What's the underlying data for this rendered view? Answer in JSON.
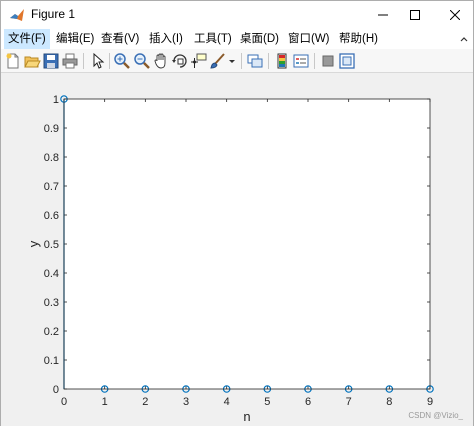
{
  "window": {
    "title": "Figure 1"
  },
  "menu": {
    "items": [
      {
        "label": "文件(F)"
      },
      {
        "label": "编辑(E)"
      },
      {
        "label": "查看(V)"
      },
      {
        "label": "插入(I)"
      },
      {
        "label": "工具(T)"
      },
      {
        "label": "桌面(D)"
      },
      {
        "label": "窗口(W)"
      },
      {
        "label": "帮助(H)"
      }
    ]
  },
  "toolbar": {
    "icons": [
      "new-figure-icon",
      "open-file-icon",
      "save-icon",
      "print-icon",
      "pointer-icon",
      "zoom-in-icon",
      "zoom-out-icon",
      "pan-icon",
      "rotate-3d-icon",
      "data-cursor-icon",
      "brush-icon",
      "link-plot-icon",
      "colorbar-icon",
      "legend-icon",
      "hide-plot-tools-icon",
      "show-plot-tools-icon"
    ]
  },
  "colors": {
    "series": "#0072bd",
    "axes": "#262626",
    "plot_bg": "#ffffff",
    "figure_bg": "#f0f0f0"
  },
  "chart_data": {
    "type": "stem",
    "title": "",
    "xlabel": "n",
    "ylabel": "y",
    "x": [
      0,
      1,
      2,
      3,
      4,
      5,
      6,
      7,
      8,
      9
    ],
    "y": [
      1,
      0,
      0,
      0,
      0,
      0,
      0,
      0,
      0,
      0
    ],
    "xlim": [
      0,
      9
    ],
    "ylim": [
      0,
      1
    ],
    "xticks": [
      "0",
      "1",
      "2",
      "3",
      "4",
      "5",
      "6",
      "7",
      "8",
      "9"
    ],
    "yticks": [
      "0",
      "0.1",
      "0.2",
      "0.3",
      "0.4",
      "0.5",
      "0.6",
      "0.7",
      "0.8",
      "0.9",
      "1"
    ],
    "grid": false,
    "marker": "circle"
  },
  "watermark": "CSDN @Vizio_"
}
